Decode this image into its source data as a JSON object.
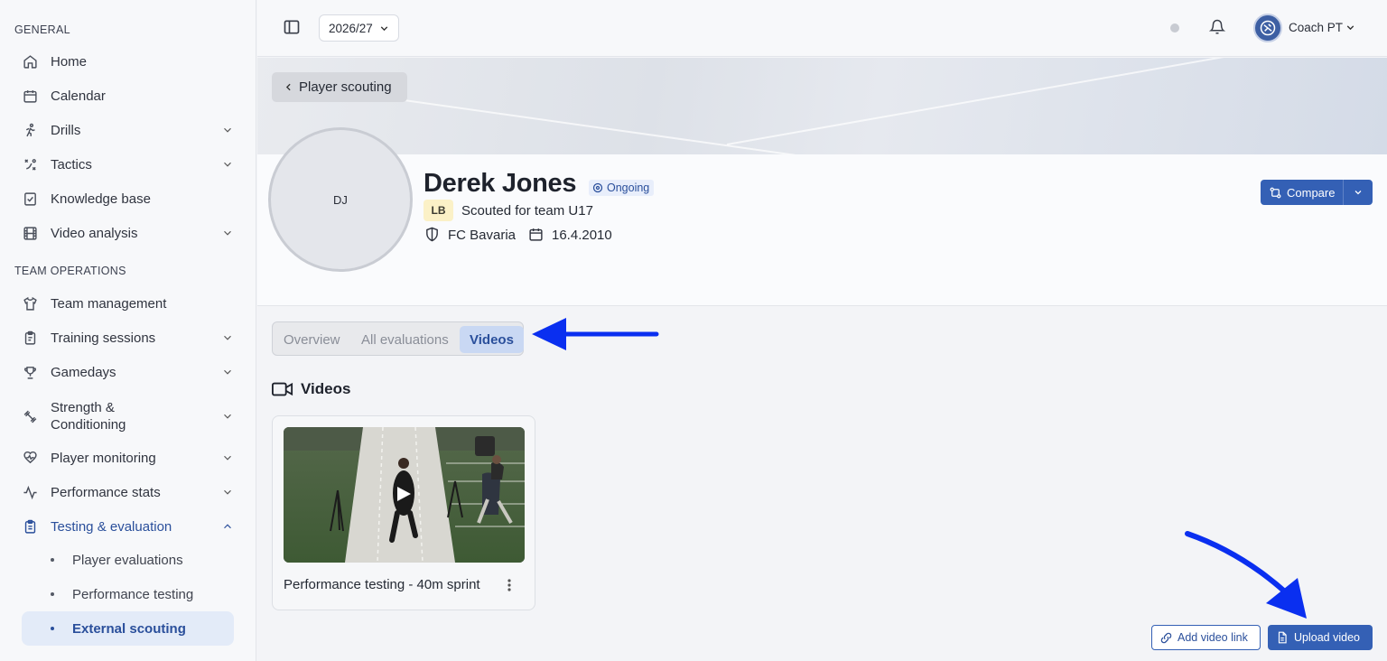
{
  "sidebar": {
    "sections": [
      {
        "title": "GENERAL"
      },
      {
        "title": "TEAM OPERATIONS"
      }
    ],
    "items": [
      {
        "label": "Home"
      },
      {
        "label": "Calendar"
      },
      {
        "label": "Drills"
      },
      {
        "label": "Tactics"
      },
      {
        "label": "Knowledge base"
      },
      {
        "label": "Video analysis"
      },
      {
        "label": "Team management"
      },
      {
        "label": "Training sessions"
      },
      {
        "label": "Gamedays"
      },
      {
        "label": "Strength &\nConditioning"
      },
      {
        "label": "Player monitoring"
      },
      {
        "label": "Performance stats"
      },
      {
        "label": "Testing & evaluation"
      }
    ],
    "subitems": [
      {
        "label": "Player evaluations"
      },
      {
        "label": "Performance testing"
      },
      {
        "label": "External scouting"
      }
    ]
  },
  "topbar": {
    "season": "2026/27",
    "user_name": "Coach PT"
  },
  "profile": {
    "back_label": "Player scouting",
    "initials": "DJ",
    "name": "Derek Jones",
    "status": "Ongoing",
    "position": "LB",
    "scouted_for": "Scouted for team U17",
    "club": "FC Bavaria",
    "dob": "16.4.2010",
    "compare_label": "Compare"
  },
  "tabs": [
    {
      "label": "Overview"
    },
    {
      "label": "All evaluations"
    },
    {
      "label": "Videos"
    }
  ],
  "videos": {
    "title": "Videos",
    "items": [
      {
        "title": "Performance testing - 40m sprint"
      }
    ],
    "add_link_label": "Add video link",
    "upload_label": "Upload video"
  },
  "colors": {
    "accent": "#3460b5",
    "active_bg": "#e3ebf8",
    "annotation_arrow": "#0a2ff0"
  }
}
